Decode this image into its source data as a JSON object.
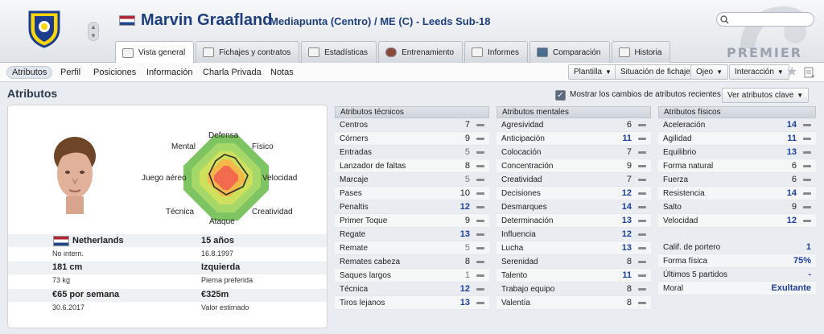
{
  "header": {
    "player_name": "Marvin Graafland",
    "subtitle": "Mediapunta (Centro) / ME (C) - Leeds Sub-18",
    "watermark": "PREMIER",
    "crest_icon": "leeds-crest-icon"
  },
  "tabs": [
    {
      "label": "Vista general",
      "active": true
    },
    {
      "label": "Fichajes y contratos"
    },
    {
      "label": "Estadísticas"
    },
    {
      "label": "Entrenamiento"
    },
    {
      "label": "Informes"
    },
    {
      "label": "Comparación"
    },
    {
      "label": "Historia"
    }
  ],
  "subnav": {
    "items": [
      "Atributos",
      "Perfil",
      "Posiciones",
      "Información",
      "Charla Privada",
      "Notas"
    ],
    "buttons": [
      "Plantilla",
      "Situación de fichaje",
      "Ojeo",
      "Interacción"
    ]
  },
  "section": {
    "title": "Atributos",
    "checkbox_label": "Mostrar los cambios de atributos recientes",
    "key_attrs_button": "Ver atributos clave"
  },
  "radar": {
    "labels": [
      "Defensa",
      "Físico",
      "Velocidad",
      "Creatividad",
      "Ataque",
      "Técnica",
      "Juego aéreo",
      "Mental"
    ]
  },
  "profile": {
    "nationality": "Netherlands",
    "intl": "No intern.",
    "age": "15 años",
    "dob": "16.8.1997",
    "height": "181 cm",
    "weight": "73 kg",
    "foot": "Izquierda",
    "foot_label": "Pierna preferida",
    "wage": "€65 por semana",
    "contract_end": "30.6.2017",
    "value": "€325m",
    "value_label": "Valor estimado"
  },
  "technical": {
    "title": "Atributos técnicos",
    "rows": [
      {
        "name": "Centros",
        "value": "7"
      },
      {
        "name": "Córners",
        "value": "9"
      },
      {
        "name": "Entradas",
        "value": "5"
      },
      {
        "name": "Lanzador de faltas",
        "value": "8"
      },
      {
        "name": "Marcaje",
        "value": "5"
      },
      {
        "name": "Pases",
        "value": "10"
      },
      {
        "name": "Penaltis",
        "value": "12"
      },
      {
        "name": "Primer Toque",
        "value": "9"
      },
      {
        "name": "Regate",
        "value": "13"
      },
      {
        "name": "Remate",
        "value": "5"
      },
      {
        "name": "Remates cabeza",
        "value": "8"
      },
      {
        "name": "Saques largos",
        "value": "1"
      },
      {
        "name": "Técnica",
        "value": "12"
      },
      {
        "name": "Tiros lejanos",
        "value": "13"
      }
    ]
  },
  "mental": {
    "title": "Atributos mentales",
    "rows": [
      {
        "name": "Agresividad",
        "value": "6"
      },
      {
        "name": "Anticipación",
        "value": "11"
      },
      {
        "name": "Colocación",
        "value": "7"
      },
      {
        "name": "Concentración",
        "value": "9"
      },
      {
        "name": "Creatividad",
        "value": "7"
      },
      {
        "name": "Decisiones",
        "value": "12"
      },
      {
        "name": "Desmarques",
        "value": "14"
      },
      {
        "name": "Determinación",
        "value": "13"
      },
      {
        "name": "Influencia",
        "value": "12"
      },
      {
        "name": "Lucha",
        "value": "13"
      },
      {
        "name": "Serenidad",
        "value": "8"
      },
      {
        "name": "Talento",
        "value": "11"
      },
      {
        "name": "Trabajo equipo",
        "value": "8"
      },
      {
        "name": "Valentía",
        "value": "8"
      }
    ]
  },
  "physical": {
    "title": "Atributos físicos",
    "rows": [
      {
        "name": "Aceleración",
        "value": "14"
      },
      {
        "name": "Agilidad",
        "value": "11"
      },
      {
        "name": "Equilibrio",
        "value": "13"
      },
      {
        "name": "Forma natural",
        "value": "6"
      },
      {
        "name": "Fuerza",
        "value": "6"
      },
      {
        "name": "Resistencia",
        "value": "14"
      },
      {
        "name": "Salto",
        "value": "9"
      },
      {
        "name": "Velocidad",
        "value": "12"
      }
    ],
    "extra": [
      {
        "name": "Calif. de portero",
        "value": "1"
      },
      {
        "name": "Forma física",
        "value": "75%"
      },
      {
        "name": "Últimos 5 partidos",
        "value": "-"
      },
      {
        "name": "Moral",
        "value": "Exultante"
      }
    ]
  }
}
